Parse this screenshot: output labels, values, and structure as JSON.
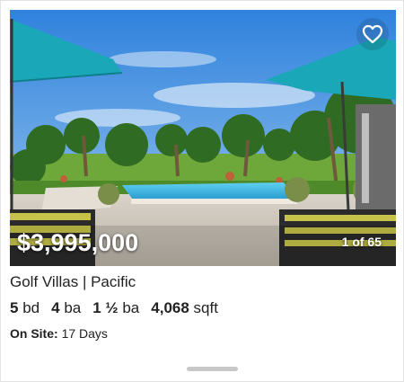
{
  "listing": {
    "price": "$3,995,000",
    "photo_counter": "1 of 65",
    "title": "Golf Villas | Pacific",
    "beds_value": "5",
    "beds_unit": "bd",
    "baths_value": "4",
    "baths_unit": "ba",
    "half_baths_value": "1 ½",
    "half_baths_unit": "ba",
    "sqft_value": "4,068",
    "sqft_unit": "sqft",
    "on_site_label": "On Site:",
    "on_site_value": "17 Days"
  },
  "icons": {
    "favorite": "heart-outline-icon"
  },
  "colors": {
    "sky": "#3d8fe0",
    "umbrella": "#1aa7b8",
    "pool": "#38b6e0",
    "lawn": "#5c9a2e",
    "stripes": "#c7c34a"
  }
}
